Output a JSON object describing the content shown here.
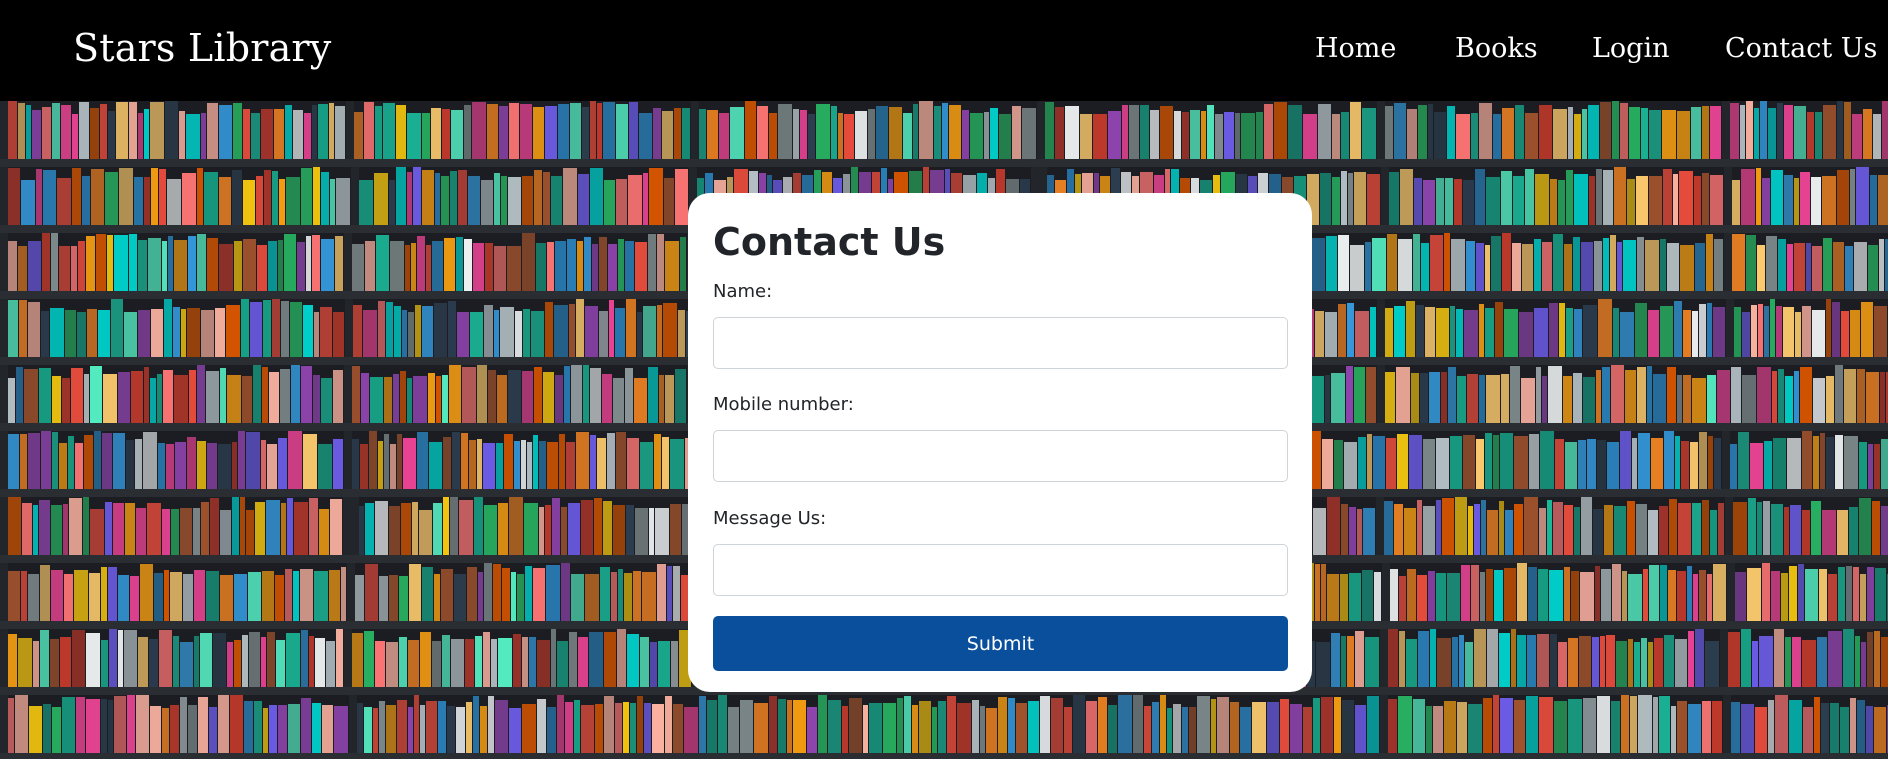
{
  "navbar": {
    "brand": "Stars Library",
    "links": {
      "home": "Home",
      "books": "Books",
      "login": "Login",
      "contact": "Contact Us"
    }
  },
  "contact_form": {
    "title": "Contact Us",
    "fields": {
      "name": {
        "label": "Name:",
        "value": "",
        "placeholder": ""
      },
      "mobile": {
        "label": "Mobile number:",
        "value": "",
        "placeholder": ""
      },
      "message": {
        "label": "Message Us:",
        "value": "",
        "placeholder": ""
      }
    },
    "submit_label": "Submit"
  },
  "colors": {
    "navbar_bg": "#000000",
    "card_bg": "#ffffff",
    "submit_bg": "#0a4f9c",
    "text": "#212529"
  },
  "background": {
    "icon": "bookshelf-image"
  }
}
